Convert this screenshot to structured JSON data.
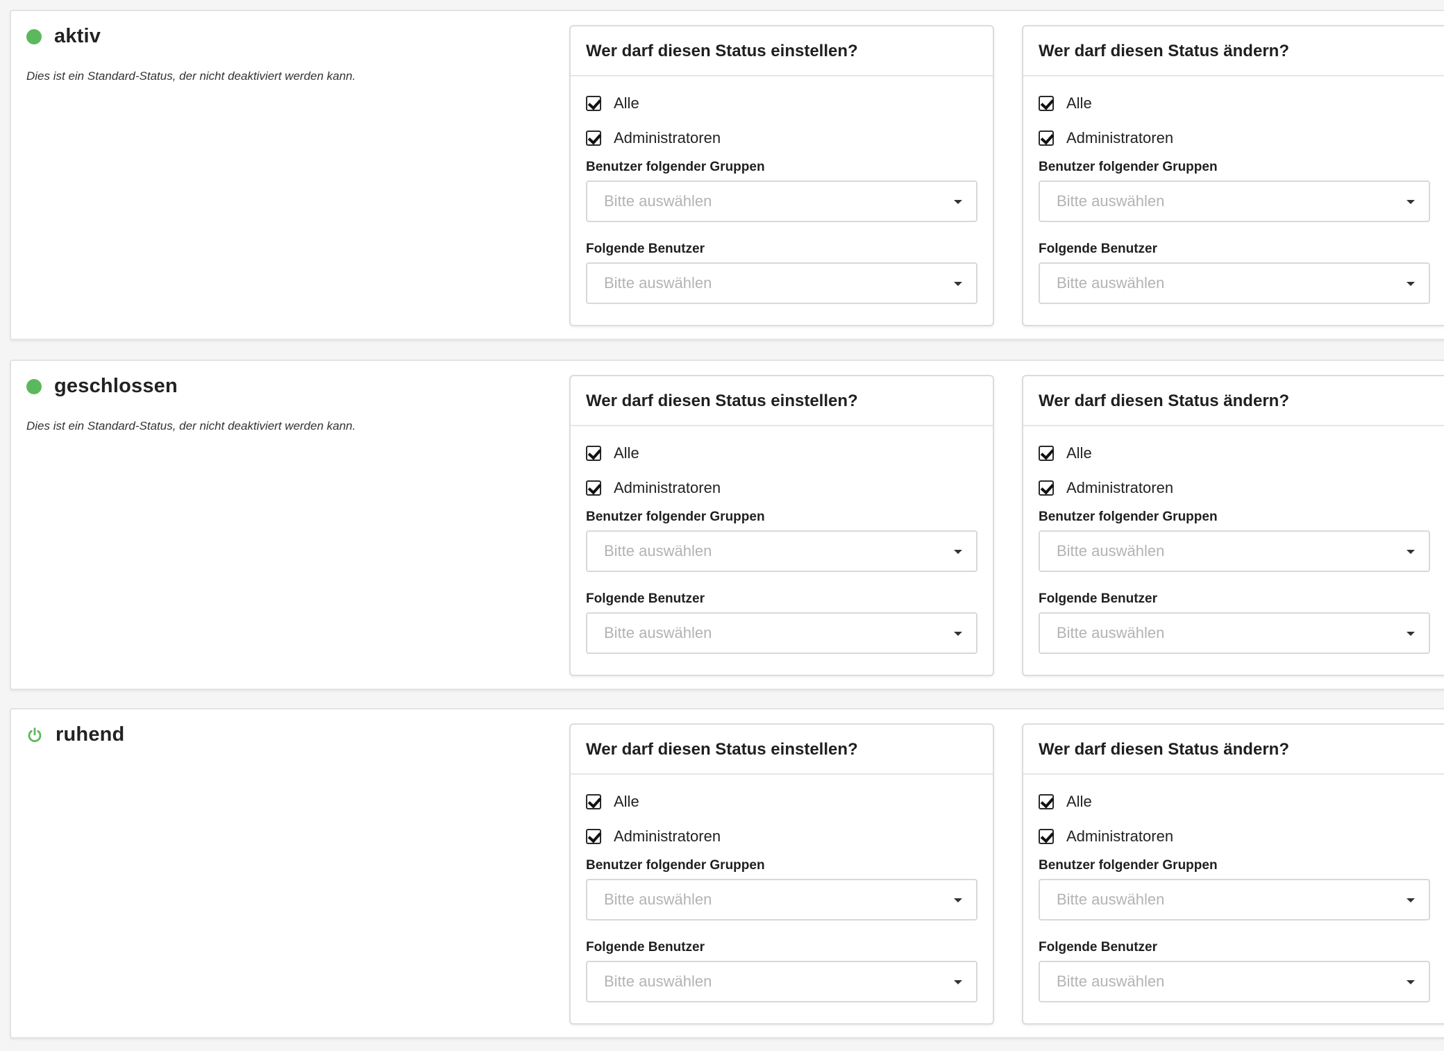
{
  "statuses": [
    {
      "name": "aktiv",
      "icon": "green-dot-icon",
      "description": "Dies ist ein Standard-Status, der nicht deaktiviert werden kann.",
      "set_panel": {
        "title": "Wer darf diesen Status einstellen?",
        "check_all": "Alle",
        "check_admins": "Administratoren",
        "groups_label": "Benutzer folgender Gruppen",
        "groups_placeholder": "Bitte auswählen",
        "users_label": "Folgende Benutzer",
        "users_placeholder": "Bitte auswählen"
      },
      "change_panel": {
        "title": "Wer darf diesen Status ändern?",
        "check_all": "Alle",
        "check_admins": "Administratoren",
        "groups_label": "Benutzer folgender Gruppen",
        "groups_placeholder": "Bitte auswählen",
        "users_label": "Folgende Benutzer",
        "users_placeholder": "Bitte auswählen"
      }
    },
    {
      "name": "geschlossen",
      "icon": "green-dot-icon",
      "description": "Dies ist ein Standard-Status, der nicht deaktiviert werden kann.",
      "set_panel": {
        "title": "Wer darf diesen Status einstellen?",
        "check_all": "Alle",
        "check_admins": "Administratoren",
        "groups_label": "Benutzer folgender Gruppen",
        "groups_placeholder": "Bitte auswählen",
        "users_label": "Folgende Benutzer",
        "users_placeholder": "Bitte auswählen"
      },
      "change_panel": {
        "title": "Wer darf diesen Status ändern?",
        "check_all": "Alle",
        "check_admins": "Administratoren",
        "groups_label": "Benutzer folgender Gruppen",
        "groups_placeholder": "Bitte auswählen",
        "users_label": "Folgende Benutzer",
        "users_placeholder": "Bitte auswählen"
      }
    },
    {
      "name": "ruhend",
      "icon": "power-icon",
      "description": "",
      "set_panel": {
        "title": "Wer darf diesen Status einstellen?",
        "check_all": "Alle",
        "check_admins": "Administratoren",
        "groups_label": "Benutzer folgender Gruppen",
        "groups_placeholder": "Bitte auswählen",
        "users_label": "Folgende Benutzer",
        "users_placeholder": "Bitte auswählen"
      },
      "change_panel": {
        "title": "Wer darf diesen Status ändern?",
        "check_all": "Alle",
        "check_admins": "Administratoren",
        "groups_label": "Benutzer folgender Gruppen",
        "groups_placeholder": "Bitte auswählen",
        "users_label": "Folgende Benutzer",
        "users_placeholder": "Bitte auswählen"
      }
    }
  ],
  "colors": {
    "status_green": "#5cb85c",
    "page_bg": "#f5f5f5",
    "placeholder": "#b3b3b3"
  }
}
